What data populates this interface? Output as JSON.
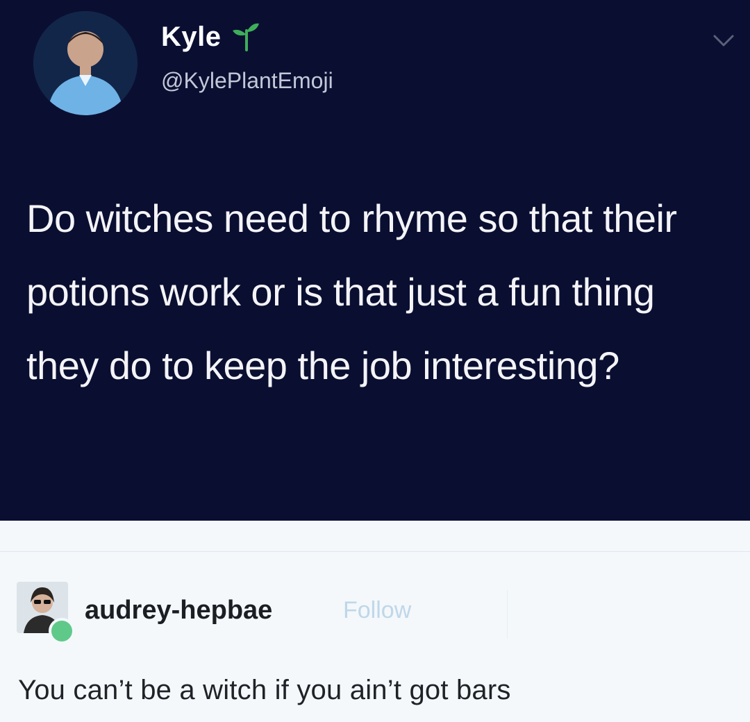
{
  "tweet": {
    "author": {
      "display_name": "Kyle",
      "handle": "@KylePlantEmoji",
      "name_emoji_icon": "sprout-icon"
    },
    "text": "Do witches need to rhyme so that their potions work or is that just a fun thing they do to keep the job interesting?",
    "menu_icon": "chevron-down-icon"
  },
  "reply": {
    "username": "audrey-hepbae",
    "follow_label": "Follow",
    "text": "You can’t be a witch if you ain’t got bars"
  },
  "colors": {
    "tweet_background": "#0a0f31",
    "reply_background": "#f4f8fb",
    "follow_color": "#bfd7e8",
    "sprout_green": "#3fae5a"
  }
}
